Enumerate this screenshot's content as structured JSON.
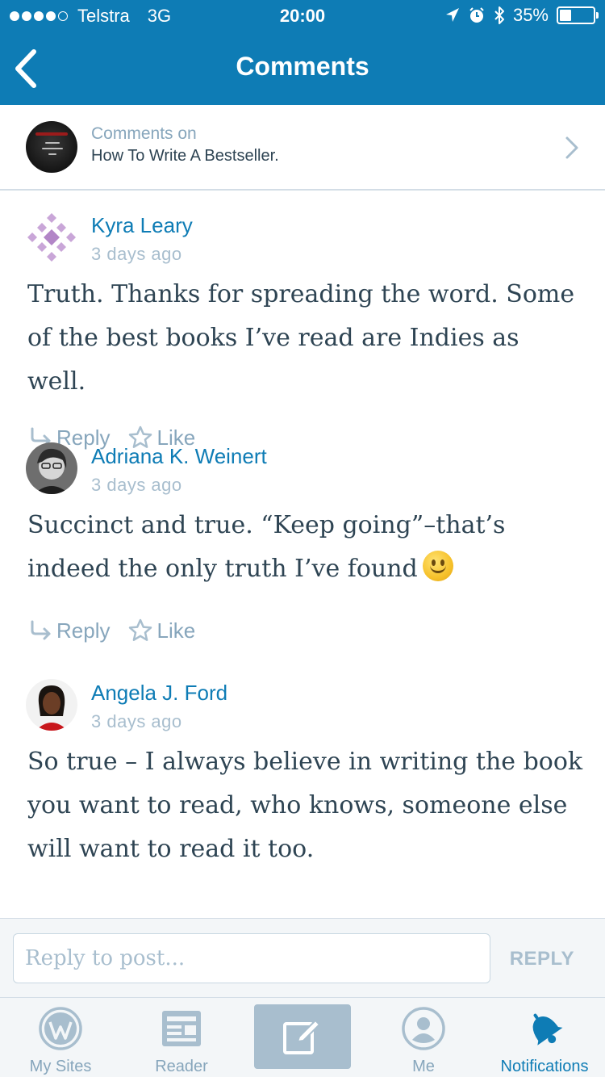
{
  "status_bar": {
    "carrier": "Telstra",
    "network": "3G",
    "time": "20:00",
    "battery": "35%",
    "battery_level": 0.35,
    "signal_bars_filled": 4,
    "icons": [
      "location-arrow-icon",
      "alarm-clock-icon",
      "bluetooth-icon",
      "battery-icon"
    ]
  },
  "header": {
    "title": "Comments",
    "back_icon": "chevron-left-icon",
    "color": "#0e7cb5"
  },
  "post": {
    "label": "Comments on",
    "title": "How To Write A Bestseller."
  },
  "comments": [
    {
      "author": "Kyra Leary",
      "date": "3 days ago",
      "text": "Truth. Thanks for spreading the word. Some of the best books I’ve read are Indies as well.",
      "reply_label": "Reply",
      "like_label": "Like"
    },
    {
      "author": "Adriana K. Weinert",
      "date": "3 days ago",
      "text": "Succinct and true. “Keep going”–that’s indeed the only truth I’ve found",
      "emoji": "slightly-smiling-face",
      "reply_label": "Reply",
      "like_label": "Like"
    },
    {
      "author": "Angela J. Ford",
      "date": "3 days ago",
      "text": "So true – I always believe in writing the book you want to read, who knows, someone else will want to read it too."
    }
  ],
  "reply_bar": {
    "placeholder": "Reply to post...",
    "button_label": "REPLY"
  },
  "tabbar": {
    "items": [
      {
        "label": "My Sites",
        "icon": "wordpress-icon"
      },
      {
        "label": "Reader",
        "icon": "reader-icon"
      },
      {
        "label": "",
        "icon": "write-post-icon"
      },
      {
        "label": "Me",
        "icon": "profile-icon"
      },
      {
        "label": "Notifications",
        "icon": "bell-icon",
        "active": true
      }
    ]
  },
  "colors": {
    "accent": "#0e7cb5",
    "muted": "#87a6bc",
    "text": "#2e4453",
    "date": "#a8bece"
  }
}
